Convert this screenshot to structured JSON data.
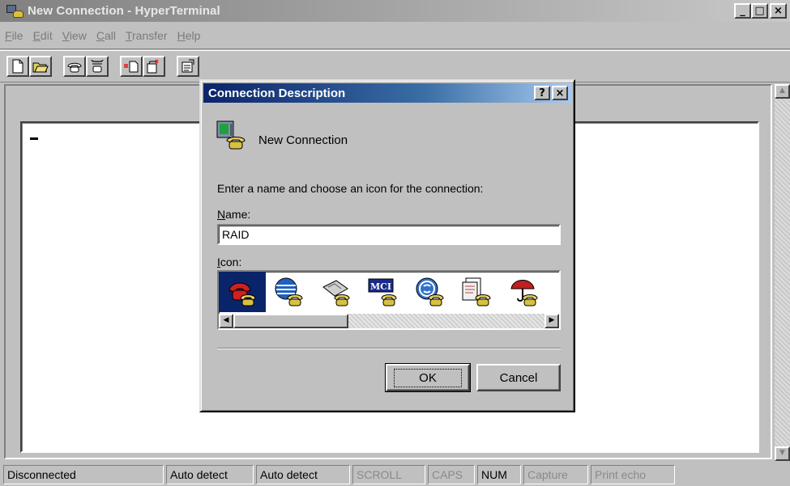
{
  "window": {
    "title": "New Connection - HyperTerminal",
    "controls": [
      "_",
      "□",
      "×"
    ]
  },
  "menu": [
    {
      "key": "F",
      "rest": "ile"
    },
    {
      "key": "E",
      "rest": "dit"
    },
    {
      "key": "V",
      "rest": "iew"
    },
    {
      "key": "C",
      "rest": "all"
    },
    {
      "key": "T",
      "rest": "ransfer"
    },
    {
      "key": "H",
      "rest": "elp"
    }
  ],
  "toolbar": {
    "icons": [
      "new-document-icon",
      "open-folder-icon",
      "call-icon",
      "disconnect-icon",
      "send-file-icon",
      "receive-file-icon",
      "properties-icon"
    ]
  },
  "dialog": {
    "title": "Connection Description",
    "help": "?",
    "close": "×",
    "connection_name_display": "New Connection",
    "prompt": "Enter a name and choose an icon for the connection:",
    "name_label_key": "N",
    "name_label_rest": "ame:",
    "name_value": "RAID",
    "icon_label_key": "I",
    "icon_label_rest": "con:",
    "icons": [
      "red-phone-icon",
      "globe-phone-icon",
      "fax-phone-icon",
      "mci-phone-icon",
      "ge-phone-icon",
      "documents-phone-icon",
      "umbrella-phone-icon"
    ],
    "ok_label": "OK",
    "cancel_label": "Cancel"
  },
  "status": {
    "panels": [
      {
        "text": "Disconnected",
        "dim": false
      },
      {
        "text": "Auto detect",
        "dim": false
      },
      {
        "text": "Auto detect",
        "dim": false
      },
      {
        "text": "SCROLL",
        "dim": true
      },
      {
        "text": "CAPS",
        "dim": true
      },
      {
        "text": "NUM",
        "dim": false
      },
      {
        "text": "Capture",
        "dim": true
      },
      {
        "text": "Print echo",
        "dim": true
      }
    ]
  }
}
